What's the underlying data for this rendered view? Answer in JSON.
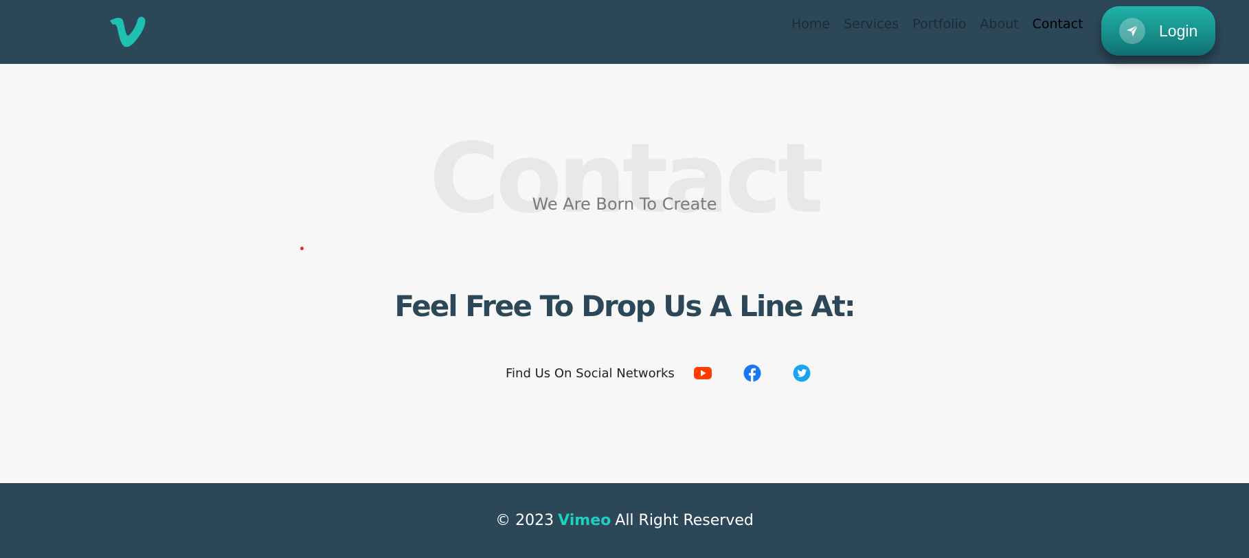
{
  "navbar": {
    "logo_icon": "vimeo-logo",
    "links": [
      {
        "label": "Home"
      },
      {
        "label": "Services"
      },
      {
        "label": "Portfolio"
      },
      {
        "label": "About"
      },
      {
        "label": "Contact",
        "active": true
      }
    ],
    "login_label": "Login",
    "login_icon": "paper-plane-icon"
  },
  "hero": {
    "background_word": "Contact",
    "subtitle": "We Are Born To Create",
    "headline": "Feel Free To Drop Us A Line At:",
    "social_label": "Find Us On Social Networks",
    "social_icons": [
      "youtube-icon",
      "facebook-icon",
      "twitter-icon"
    ]
  },
  "footer": {
    "copyright": "© 2023",
    "brand": "Vimeo",
    "rights": "All Right Reserved"
  },
  "colors": {
    "navbar_bg": "#2c4757",
    "accent": "#1fcfc0",
    "youtube": "#ff3d00",
    "facebook": "#1877f2",
    "twitter": "#1da1f2"
  }
}
